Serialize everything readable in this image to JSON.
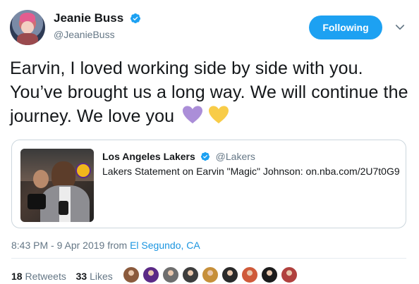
{
  "author": {
    "display_name": "Jeanie Buss",
    "handle": "@JeanieBuss",
    "verified_icon": "verified-badge-icon",
    "avatar_icon": "avatar"
  },
  "follow_button": {
    "label": "Following"
  },
  "caret_icon": "chevron-down-icon",
  "tweet": {
    "text": "Earvin, I loved working side by side with you. You’ve brought us a long way. We will continue the journey. We love you",
    "emojis": [
      {
        "icon": "purple-heart-icon",
        "color": "#ab8ed8"
      },
      {
        "icon": "yellow-heart-icon",
        "color": "#f8cc48"
      }
    ]
  },
  "quoted_tweet": {
    "display_name": "Los Angeles Lakers",
    "handle": "@Lakers",
    "text": "Lakers Statement on Earvin \"Magic\" Johnson: on.nba.com/2U7t0G9",
    "image_icon": "press-conference-photo"
  },
  "meta": {
    "timestamp": "8:43 PM - 9 Apr 2019",
    "from_label": "from",
    "location": "El Segundo, CA"
  },
  "stats": {
    "retweets_count": "18",
    "retweets_label": "Retweets",
    "likes_count": "33",
    "likes_label": "Likes"
  },
  "likers": [
    {
      "color": "#8b5a3c"
    },
    {
      "color": "#5b2a86"
    },
    {
      "color": "#6e6e6e"
    },
    {
      "color": "#3d3d3d"
    },
    {
      "color": "#c68f3a"
    },
    {
      "color": "#2a2a2a"
    },
    {
      "color": "#cf5a3a"
    },
    {
      "color": "#1c1c1c"
    },
    {
      "color": "#b0413e"
    }
  ],
  "colors": {
    "brand": "#1da1f2",
    "link": "#1b95e0",
    "muted": "#657786",
    "text": "#14171a",
    "border": "#ccd6dd"
  }
}
